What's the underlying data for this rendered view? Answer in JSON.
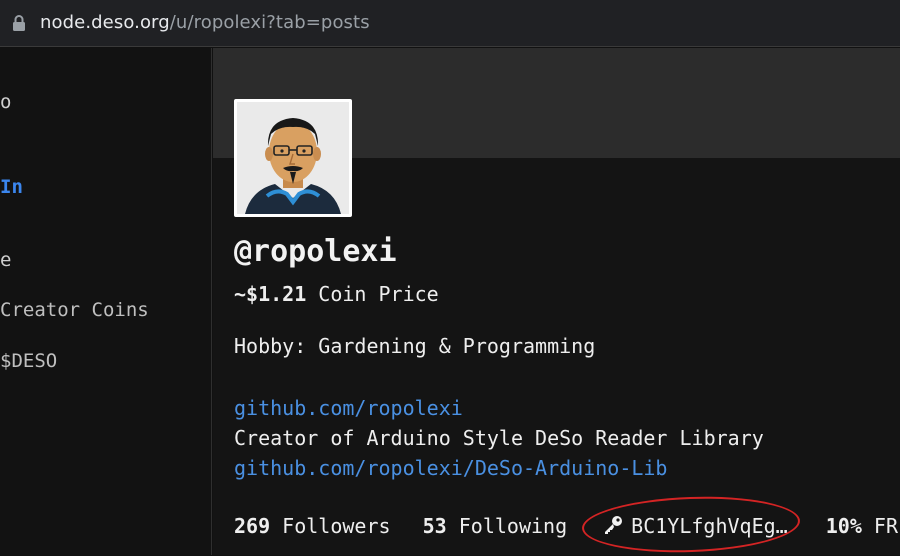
{
  "browser": {
    "url_host": "node.deso.org",
    "url_path": "/u/ropolexi?tab=posts"
  },
  "sidebar": {
    "items": [
      {
        "label": "o"
      },
      {
        "label": "In"
      },
      {
        "label": "e"
      },
      {
        "label": "Creator Coins"
      },
      {
        "label": "$DESO"
      }
    ]
  },
  "profile": {
    "username": "@ropolexi",
    "coin_price_value": "~$1.21",
    "coin_price_label": "Coin Price",
    "bio_lines": [
      {
        "text": "Hobby: Gardening & Programming",
        "link": false
      },
      {
        "text": "github.com/ropolexi",
        "link": true
      },
      {
        "text": "Creator of Arduino Style DeSo Reader Library",
        "link": false
      },
      {
        "text": "github.com/ropolexi/DeSo-Arduino-Lib",
        "link": true
      }
    ],
    "followers_count": "269",
    "followers_label": "Followers",
    "following_count": "53",
    "following_label": "Following",
    "public_key": "BC1YLfghVqEg…",
    "fr_value": "10%",
    "fr_label": "FR"
  },
  "colors": {
    "link": "#4a90e2",
    "accent_blue": "#3b86ee",
    "annotation_circle": "#d42424"
  },
  "icons": {
    "lock": "lock-icon",
    "key": "key-icon"
  }
}
